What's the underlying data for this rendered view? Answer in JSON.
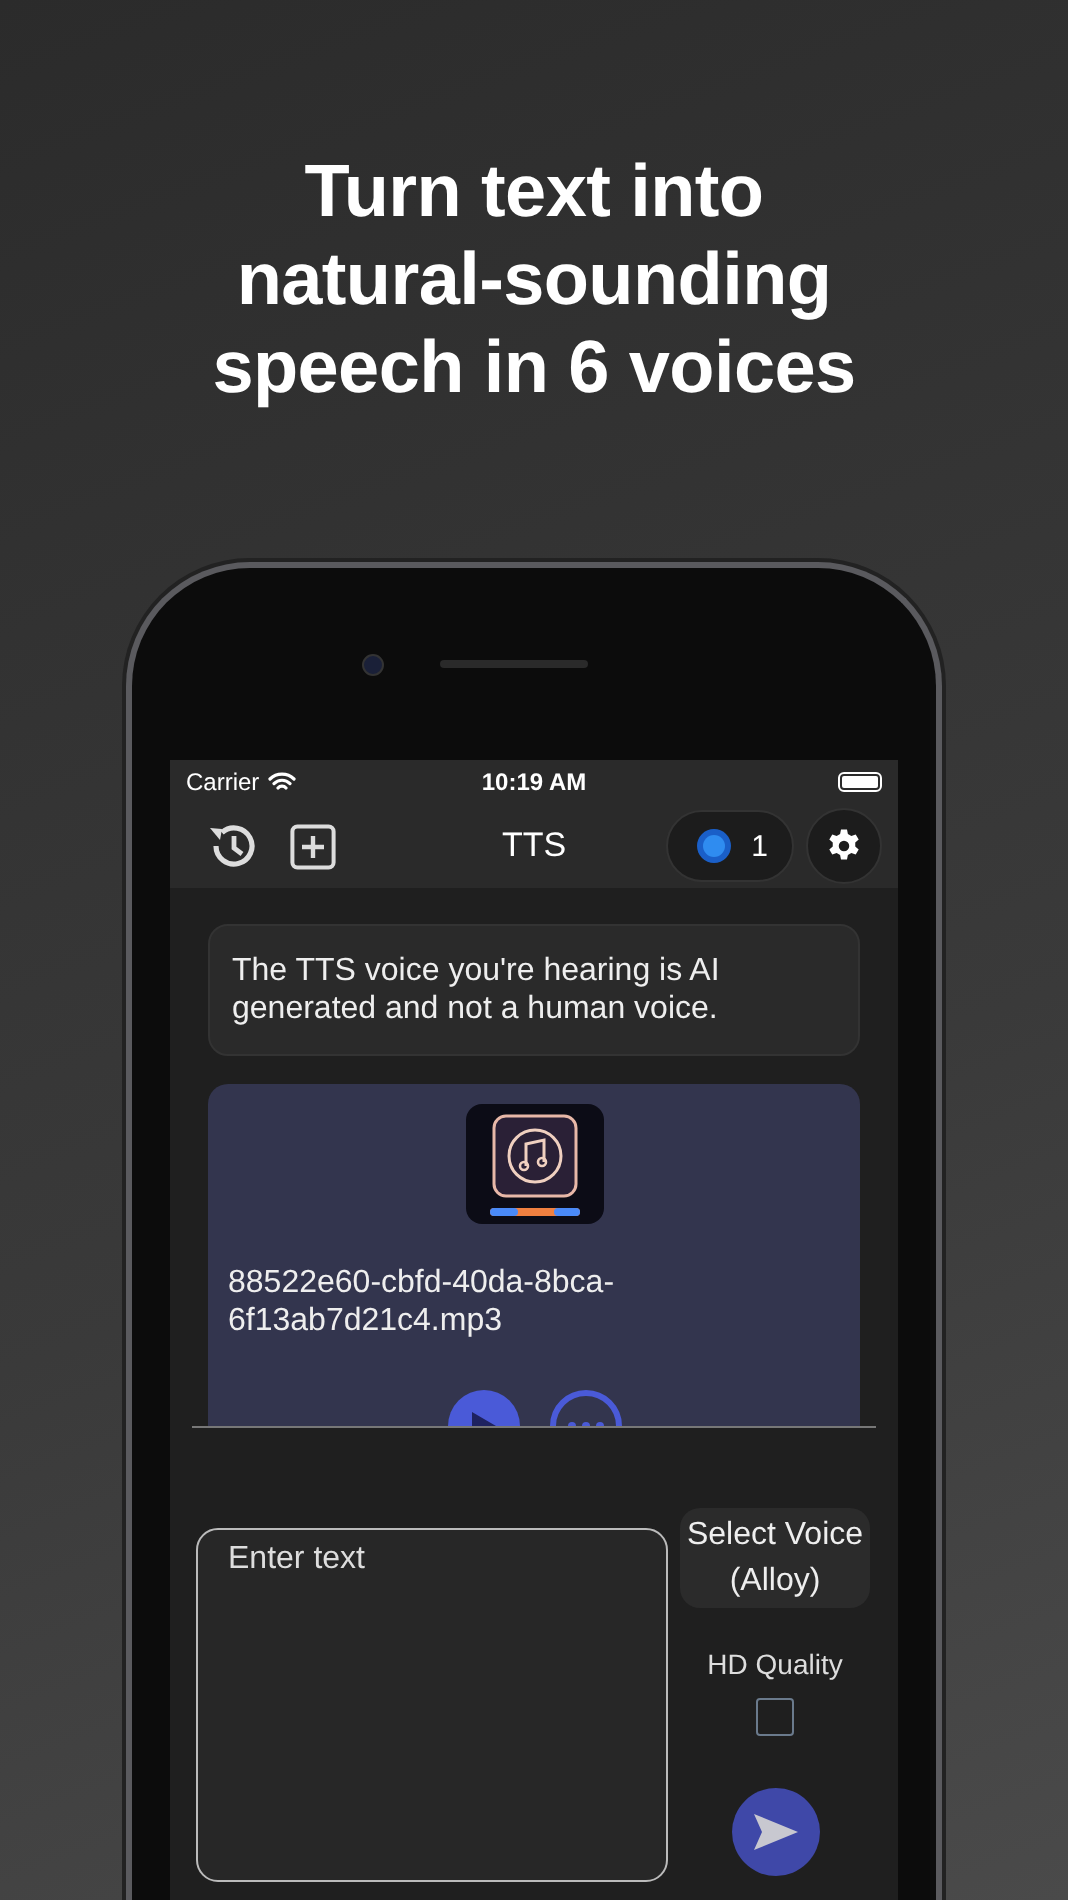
{
  "headline": [
    "Turn text into",
    "natural-sounding",
    "speech in 6 voices"
  ],
  "status_bar": {
    "carrier": "Carrier",
    "time": "10:19 AM"
  },
  "nav_bar": {
    "title": "TTS",
    "credits": "1"
  },
  "notice": "The TTS voice you're hearing is AI generated and not a human voice.",
  "audio_card": {
    "file_name": "88522e60-cbfd-40da-8bca-6f13ab7d21c4.mp3"
  },
  "composer": {
    "placeholder": "Enter text",
    "voice_button": [
      "Select Voice",
      "(Alloy)"
    ],
    "hd_label": "HD Quality",
    "hd_checked": false
  }
}
